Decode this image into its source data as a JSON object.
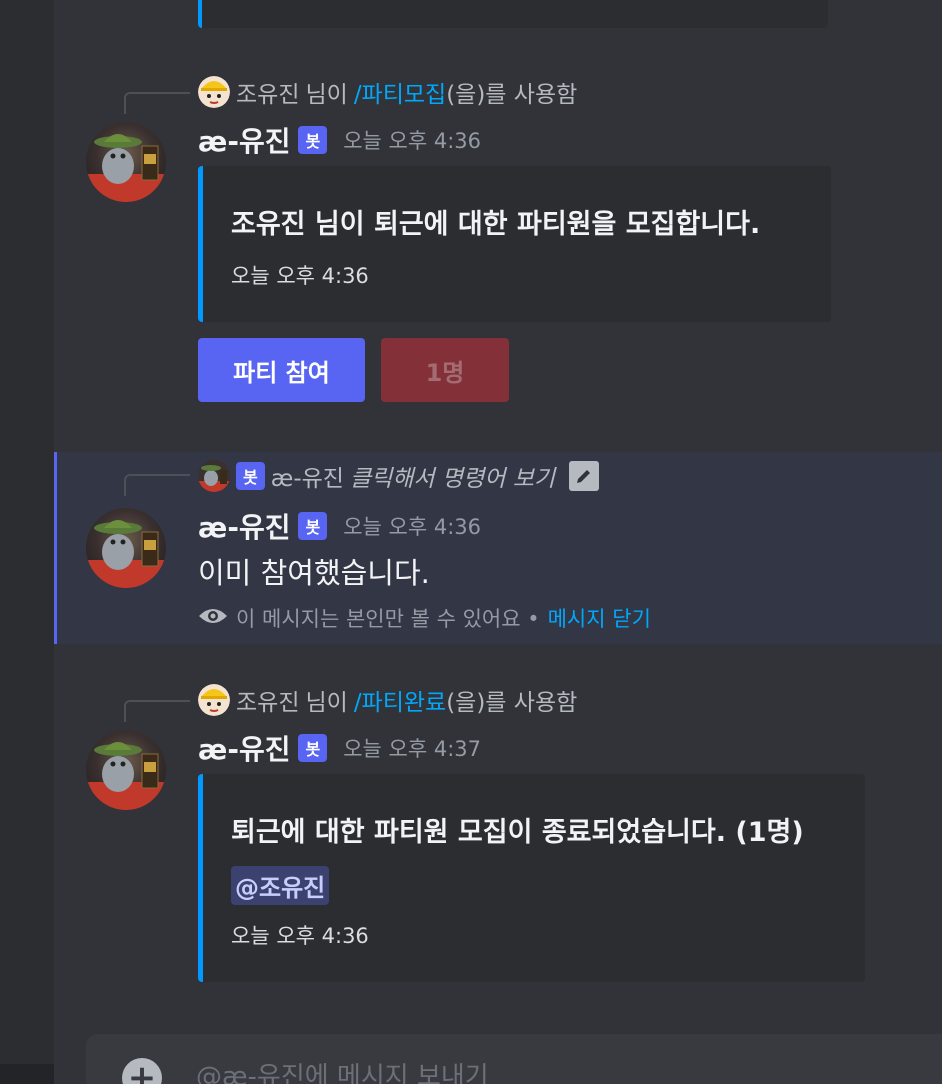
{
  "colors": {
    "background": "#313338",
    "embed_bg": "#2b2d31",
    "embed_accent": "#0099ff",
    "bot_badge": "#5865f2",
    "primary_button": "#5865f2",
    "danger_button": "#843038",
    "link": "#00a8fc"
  },
  "messages": [
    {
      "command_reply": {
        "user": "조유진",
        "prefix": "님이",
        "command": "/파티모집",
        "suffix": "(을)를 사용함"
      },
      "author": "æ-유진",
      "badge": "봇",
      "timestamp": "오늘 오후 4:36",
      "embed": {
        "title": "조유진 님이 퇴근에 대한 파티원을 모집합니다.",
        "footer": "오늘 오후 4:36"
      },
      "buttons": [
        {
          "label": "파티 참여",
          "style": "primary"
        },
        {
          "label": "1명",
          "style": "danger"
        }
      ]
    },
    {
      "command_reply": {
        "badge": "봇",
        "user": "æ-유진",
        "hint": "클릭해서 명령어 보기"
      },
      "author": "æ-유진",
      "badge": "봇",
      "timestamp": "오늘 오후 4:36",
      "content": "이미 참여했습니다.",
      "ephemeral_note": "이 메시지는 본인만 볼 수 있어요 •",
      "dismiss_label": "메시지 닫기"
    },
    {
      "command_reply": {
        "user": "조유진",
        "prefix": "님이",
        "command": "/파티완료",
        "suffix": "(을)를 사용함"
      },
      "author": "æ-유진",
      "badge": "봇",
      "timestamp": "오늘 오후 4:37",
      "embed": {
        "title": "퇴근에 대한 파티원 모집이 종료되었습니다. (1명)",
        "mention": "@조유진",
        "footer": "오늘 오후 4:36"
      }
    }
  ],
  "composer": {
    "placeholder": "@æ-유진에 메시지 보내기"
  }
}
